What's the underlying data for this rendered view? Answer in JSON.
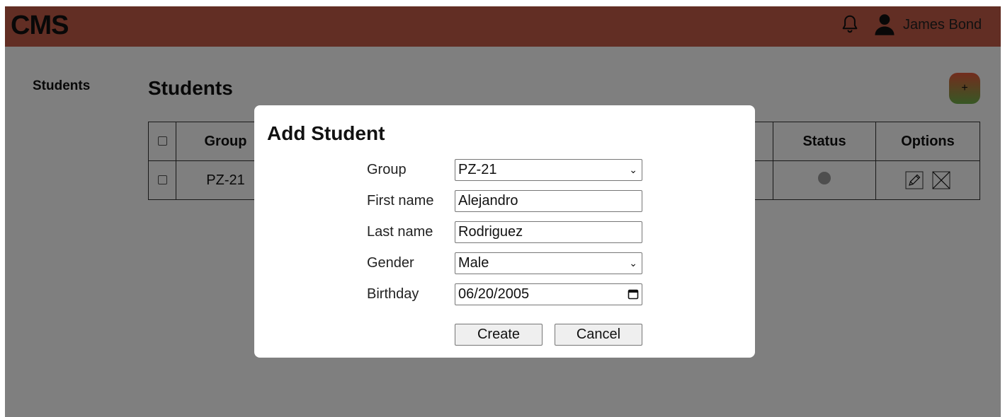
{
  "header": {
    "logo": "CMS",
    "user_name": "James Bond"
  },
  "sidebar": {
    "items": [
      {
        "label": "Students"
      }
    ]
  },
  "main": {
    "title": "Students",
    "add_button_label": "+",
    "table": {
      "columns": [
        "Group",
        "Status",
        "Options"
      ],
      "rows": [
        {
          "group": "PZ-21",
          "status": "inactive"
        }
      ]
    }
  },
  "modal": {
    "title": "Add Student",
    "fields": [
      {
        "label": "Group",
        "value": "PZ-21"
      },
      {
        "label": "First name",
        "value": "Alejandro"
      },
      {
        "label": "Last name",
        "value": "Rodriguez"
      },
      {
        "label": "Gender",
        "value": "Male"
      },
      {
        "label": "Birthday",
        "value": "06/20/2005"
      }
    ],
    "create_label": "Create",
    "cancel_label": "Cancel"
  },
  "colors": {
    "header": "#c45c48",
    "overlay": "rgba(0,0,0,0.5)",
    "status_inactive": "#9c9c9c"
  },
  "icons": [
    "bell-icon",
    "user-icon",
    "pencil-icon",
    "close-box-icon",
    "chevron-down-icon",
    "calendar-icon"
  ]
}
